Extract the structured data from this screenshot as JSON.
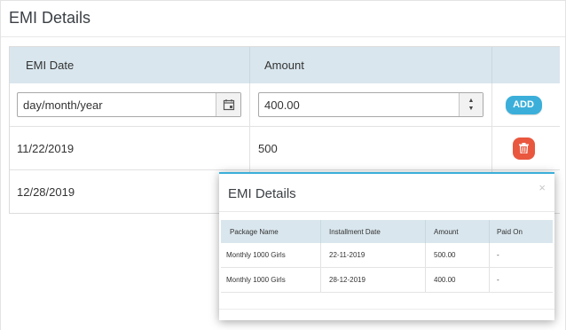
{
  "panel": {
    "title": "EMI Details"
  },
  "emi_table": {
    "headers": {
      "date": "EMI Date",
      "amount": "Amount"
    },
    "input_row": {
      "date_placeholder": "day/month/year",
      "amount_value": "400.00",
      "add_label": "ADD"
    },
    "rows": [
      {
        "date": "11/22/2019",
        "amount": "500"
      },
      {
        "date": "12/28/2019",
        "amount": ""
      }
    ]
  },
  "modal": {
    "title": "EMI Details",
    "close": "×",
    "headers": [
      "Package Name",
      "Installment Date",
      "Amount",
      "Paid On"
    ],
    "rows": [
      [
        "Monthly 1000 Girls",
        "22-11-2019",
        "500.00",
        "-"
      ],
      [
        "Monthly 1000 Girls",
        "28-12-2019",
        "400.00",
        "-"
      ]
    ]
  },
  "colors": {
    "accent": "#3bafda",
    "danger": "#e9573f",
    "header_bg": "#d9e6ed"
  },
  "icons": {
    "calendar": "calendar-icon",
    "delete": "trash-icon",
    "spinner": "spinner-arrows-icon"
  }
}
